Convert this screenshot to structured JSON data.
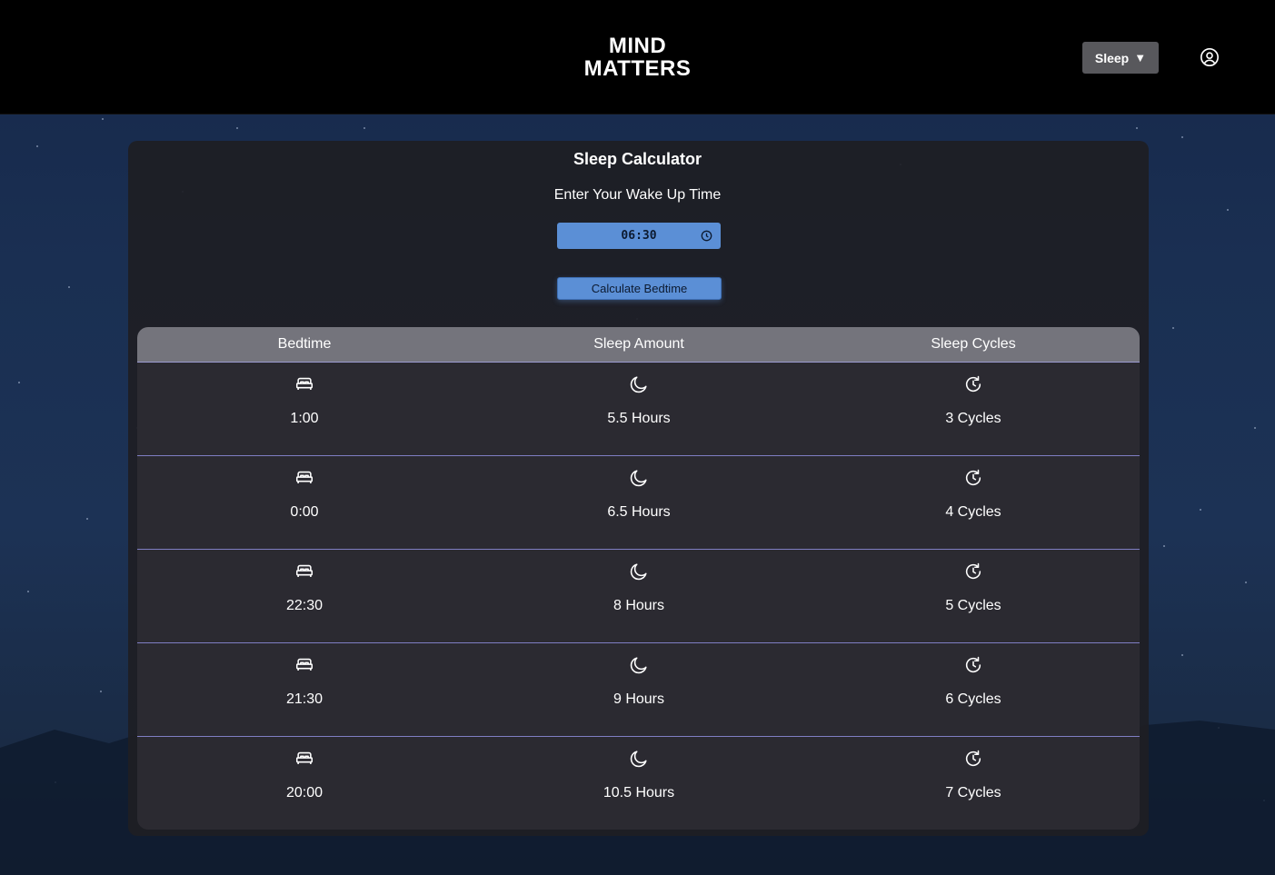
{
  "header": {
    "logo_line1": "MIND",
    "logo_line2": "MATTERS",
    "nav_dropdown_label": "Sleep",
    "nav_caret": "▼",
    "profile_icon": "user-circle-icon"
  },
  "calculator": {
    "title": "Sleep Calculator",
    "prompt": "Enter Your Wake Up Time",
    "wake_time": "06:30",
    "button_label": "Calculate Bedtime",
    "accent_color": "#5b8fd6"
  },
  "table": {
    "headers": [
      "Bedtime",
      "Sleep Amount",
      "Sleep Cycles"
    ],
    "icons": [
      "bed-icon",
      "moon-icon",
      "rotate-clock-icon"
    ],
    "rows": [
      {
        "bedtime": "1:00",
        "amount": "5.5 Hours",
        "cycles": "3 Cycles"
      },
      {
        "bedtime": "0:00",
        "amount": "6.5 Hours",
        "cycles": "4 Cycles"
      },
      {
        "bedtime": "22:30",
        "amount": "8 Hours",
        "cycles": "5 Cycles"
      },
      {
        "bedtime": "21:30",
        "amount": "9 Hours",
        "cycles": "6 Cycles"
      },
      {
        "bedtime": "20:00",
        "amount": "10.5 Hours",
        "cycles": "7 Cycles"
      }
    ]
  }
}
